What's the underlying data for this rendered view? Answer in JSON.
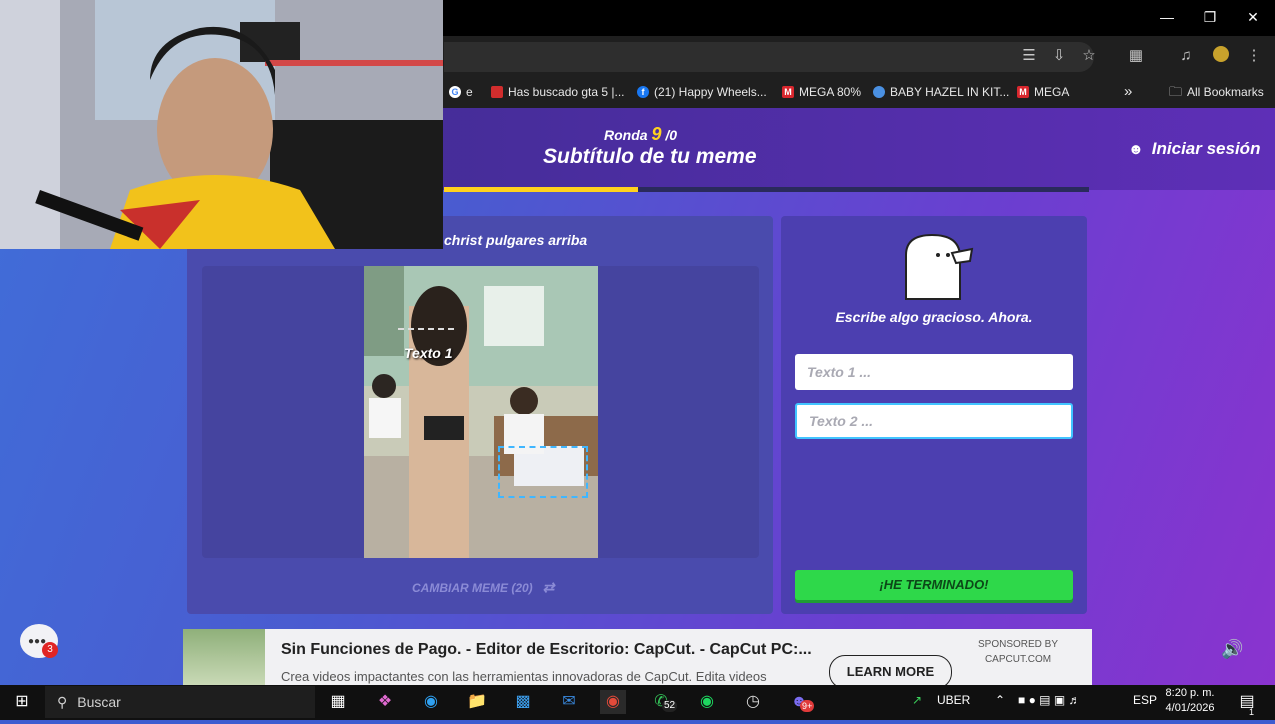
{
  "browser": {
    "bookmarks": [
      {
        "label": "e",
        "icon": "google-icon",
        "color": "#4285f4"
      },
      {
        "label": "Has buscado gta 5 |...",
        "icon": "site-icon",
        "color": "#d12d2d"
      },
      {
        "label": "(21) Happy Wheels...",
        "icon": "facebook-icon",
        "color": "#1877f2"
      },
      {
        "label": "MEGA 80%",
        "icon": "mega-icon",
        "color": "#d9272e"
      },
      {
        "label": "BABY HAZEL IN KIT...",
        "icon": "site-icon",
        "color": "#4a90e2"
      },
      {
        "label": "MEGA",
        "icon": "mega-icon",
        "color": "#d9272e"
      }
    ],
    "all_bookmarks": "All Bookmarks",
    "more_glyph": "»"
  },
  "game": {
    "round_prefix": "Ronda",
    "round_number": "9",
    "round_suffix": "/0",
    "title": "Subtítulo de tu meme",
    "login": "Iniciar sesión",
    "progress_percent": 30,
    "meme_name": "christ pulgares arriba",
    "meme_text_label": "Texto 1",
    "change_meme": "CAMBIAR MEME (20)",
    "prompt": "Escribe algo gracioso. Ahora.",
    "input1_placeholder": "Texto 1 ...",
    "input2_placeholder": "Texto 2 ...",
    "done_label": "¡HE TERMINADO!"
  },
  "ad": {
    "title": "Sin Funciones de Pago. - Editor de Escritorio: CapCut. - CapCut PC:...",
    "description": "Crea videos impactantes con las herramientas innovadoras de CapCut. Edita videos",
    "cta": "LEARN MORE",
    "sponsor_line1": "SPONSORED BY",
    "sponsor_line2": "CAPCUT.COM"
  },
  "taskbar": {
    "search_placeholder": "Buscar",
    "whatsapp_badge": "52",
    "discord_badge": "9+",
    "uber_label": "UBER",
    "language": "ESP",
    "time": "8:20 p. m.",
    "date": "4/01/2026",
    "notification_count": "1"
  },
  "chat_badge": "3",
  "colors": {
    "accent_yellow": "#ffd21e",
    "done_green": "#2ed84a",
    "panel_purple": "#4c3fb0"
  }
}
